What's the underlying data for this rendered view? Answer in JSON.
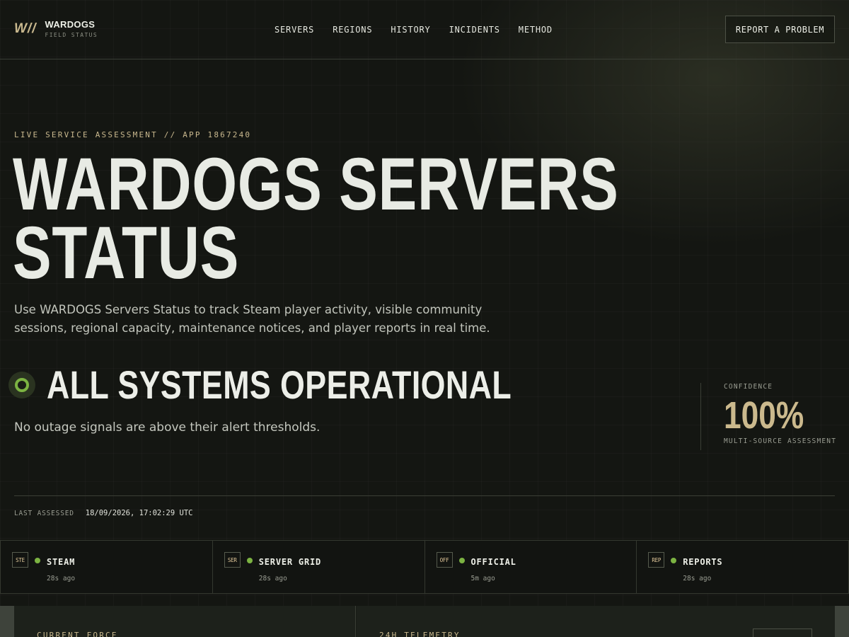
{
  "brand": {
    "mark": "W//",
    "name": "WARDOGS",
    "subtitle": "FIELD STATUS"
  },
  "nav": {
    "items": [
      "SERVERS",
      "REGIONS",
      "HISTORY",
      "INCIDENTS",
      "METHOD"
    ],
    "report_button": "REPORT A PROBLEM"
  },
  "hero": {
    "eyebrow": "LIVE SERVICE ASSESSMENT // APP 1867240",
    "title_line1": "WARDOGS SERVERS",
    "title_line2": "STATUS",
    "description": "Use WARDOGS Servers Status to track Steam player activity, visible community sessions, regional capacity, maintenance notices, and player reports in real time."
  },
  "status": {
    "title": "ALL SYSTEMS OPERATIONAL",
    "description": "No outage signals are above their alert thresholds.",
    "state_color": "#7cb342"
  },
  "confidence": {
    "label": "CONFIDENCE",
    "value": "100%",
    "sub": "MULTI-SOURCE ASSESSMENT"
  },
  "assessment": {
    "label": "LAST ASSESSED",
    "value": "18/09/2026, 17:02:29 UTC"
  },
  "sources": [
    {
      "badge": "STE",
      "name": "STEAM",
      "time": "28s ago"
    },
    {
      "badge": "SER",
      "name": "SERVER GRID",
      "time": "28s ago"
    },
    {
      "badge": "OFF",
      "name": "OFFICIAL",
      "time": "5m ago"
    },
    {
      "badge": "REP",
      "name": "REPORTS",
      "time": "28s ago"
    }
  ],
  "panels": {
    "left_label": "CURRENT FORCE",
    "right_label": "24H TELEMETRY"
  },
  "colors": {
    "accent": "#c9b88e",
    "background": "#141612",
    "ok": "#7cb342"
  }
}
